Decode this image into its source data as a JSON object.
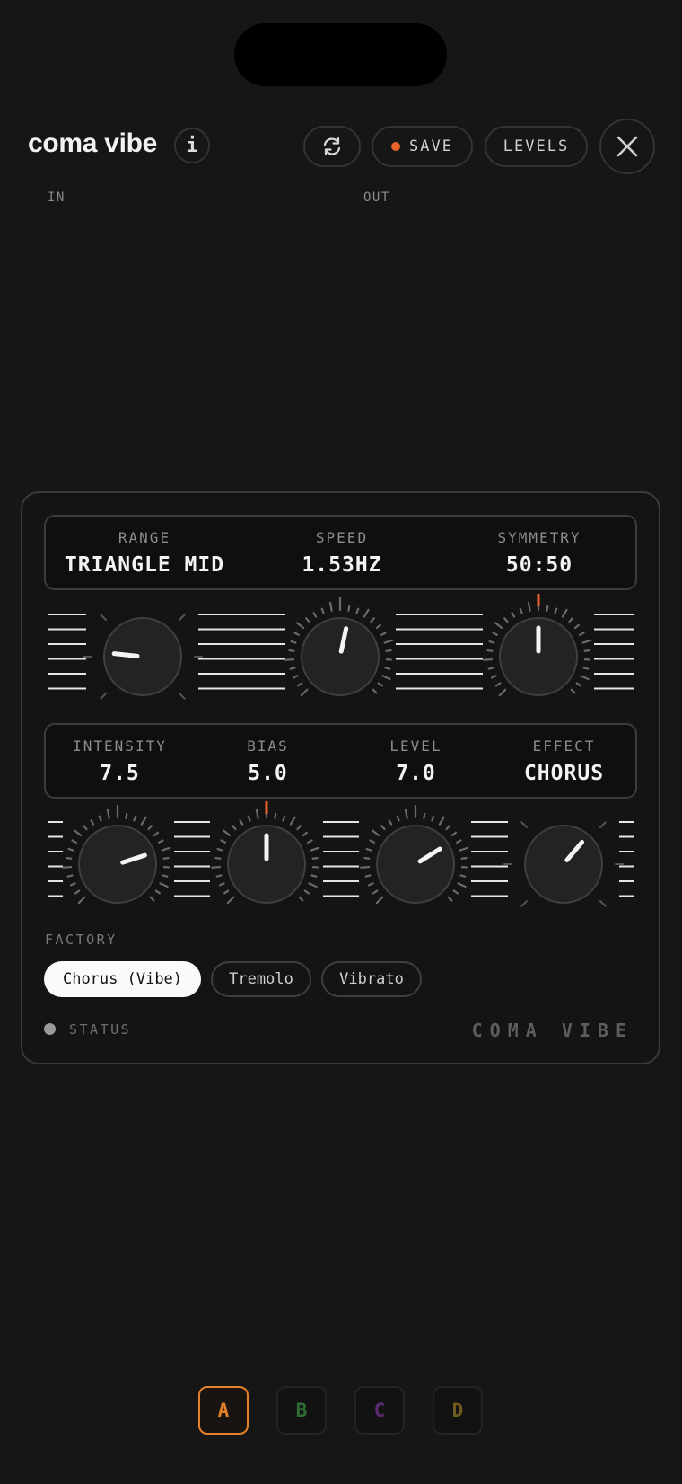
{
  "header": {
    "title": "coma vibe",
    "info_label": "i",
    "save_label": "SAVE",
    "levels_label": "LEVELS"
  },
  "meters": {
    "in_label": "IN",
    "out_label": "OUT"
  },
  "display1": [
    {
      "label": "RANGE",
      "value": "TRIANGLE MID"
    },
    {
      "label": "SPEED",
      "value": "1.53HZ"
    },
    {
      "label": "SYMMETRY",
      "value": "50:50"
    }
  ],
  "display2": [
    {
      "label": "INTENSITY",
      "value": "7.5"
    },
    {
      "label": "BIAS",
      "value": "5.0"
    },
    {
      "label": "LEVEL",
      "value": "7.0"
    },
    {
      "label": "EFFECT",
      "value": "CHORUS"
    }
  ],
  "factory": {
    "label": "FACTORY",
    "presets": [
      "Chorus (Vibe)",
      "Tremolo",
      "Vibrato"
    ],
    "active": "Chorus (Vibe)"
  },
  "status": {
    "label": "STATUS"
  },
  "brand": "COMA VIBE",
  "slots": [
    {
      "label": "A",
      "color": "#e2812a",
      "active": true
    },
    {
      "label": "B",
      "color": "#2f6b34",
      "active": false
    },
    {
      "label": "C",
      "color": "#5b2a6e",
      "active": false
    },
    {
      "label": "D",
      "color": "#6e5a1e",
      "active": false
    }
  ],
  "knobs": {
    "range": {
      "angle_deg": -84,
      "arc": false
    },
    "speed": {
      "angle_deg": 12,
      "arc": true
    },
    "symmetry": {
      "angle_deg": 0,
      "arc": true,
      "center_mark": true
    },
    "intensity": {
      "angle_deg": 72,
      "arc": true
    },
    "bias": {
      "angle_deg": 0,
      "arc": true,
      "center_mark": true
    },
    "level": {
      "angle_deg": 58,
      "arc": true
    },
    "effect": {
      "angle_deg": 40,
      "arc": false
    }
  },
  "colors": {
    "accent": "#e8622a",
    "bg": "#161616"
  }
}
